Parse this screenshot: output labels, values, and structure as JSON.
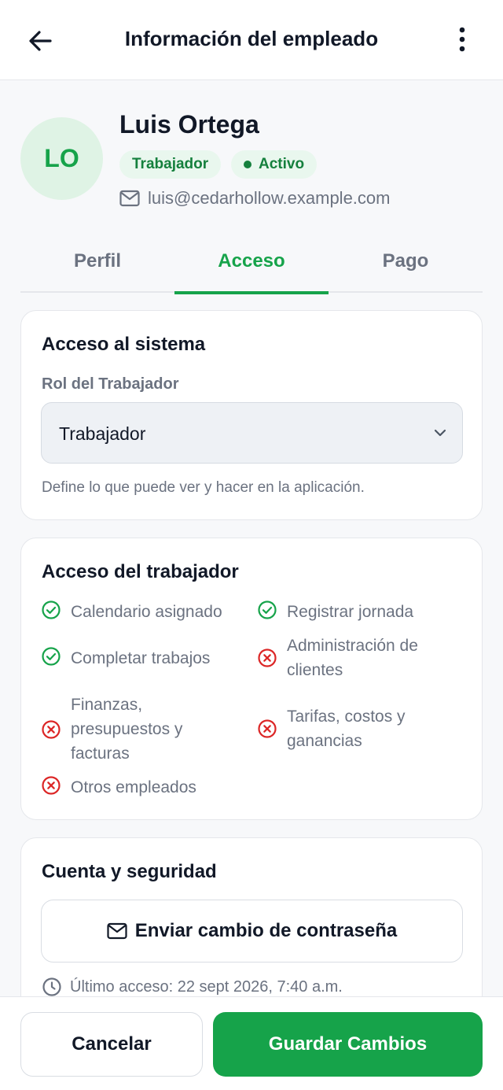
{
  "header": {
    "title": "Información del empleado",
    "back_icon": "arrow-left-icon",
    "more_icon": "more-vertical-icon"
  },
  "profile": {
    "initials": "LO",
    "name": "Luis Ortega",
    "role_badge": "Trabajador",
    "status_badge": "Activo",
    "email": "luis@cedarhollow.example.com"
  },
  "tabs": [
    {
      "label": "Perfil",
      "active": false
    },
    {
      "label": "Acceso",
      "active": true
    },
    {
      "label": "Pago",
      "active": false
    }
  ],
  "system_access": {
    "title": "Acceso al sistema",
    "role_label": "Rol del Trabajador",
    "role_value": "Trabajador",
    "helper": "Define lo que puede ver y hacer en la aplicación."
  },
  "worker_access": {
    "title": "Acceso del trabajador",
    "permissions": [
      {
        "label": "Calendario asignado",
        "allowed": true
      },
      {
        "label": "Registrar jornada",
        "allowed": true
      },
      {
        "label": "Completar trabajos",
        "allowed": true
      },
      {
        "label": "Administración de clientes",
        "allowed": false
      },
      {
        "label": "Finanzas, presupuestos y facturas",
        "allowed": false
      },
      {
        "label": "Tarifas, costos y ganancias",
        "allowed": false
      },
      {
        "label": "Otros empleados",
        "allowed": false
      }
    ]
  },
  "security": {
    "title": "Cuenta y seguridad",
    "reset_button": "Enviar cambio de contraseña",
    "last_login": "Último acceso: 22 sept 2026, 7:40 a.m."
  },
  "footer": {
    "cancel": "Cancelar",
    "save": "Guardar Cambios"
  },
  "colors": {
    "accent": "#16a34a",
    "danger": "#dc2626",
    "muted": "#6b7280"
  }
}
